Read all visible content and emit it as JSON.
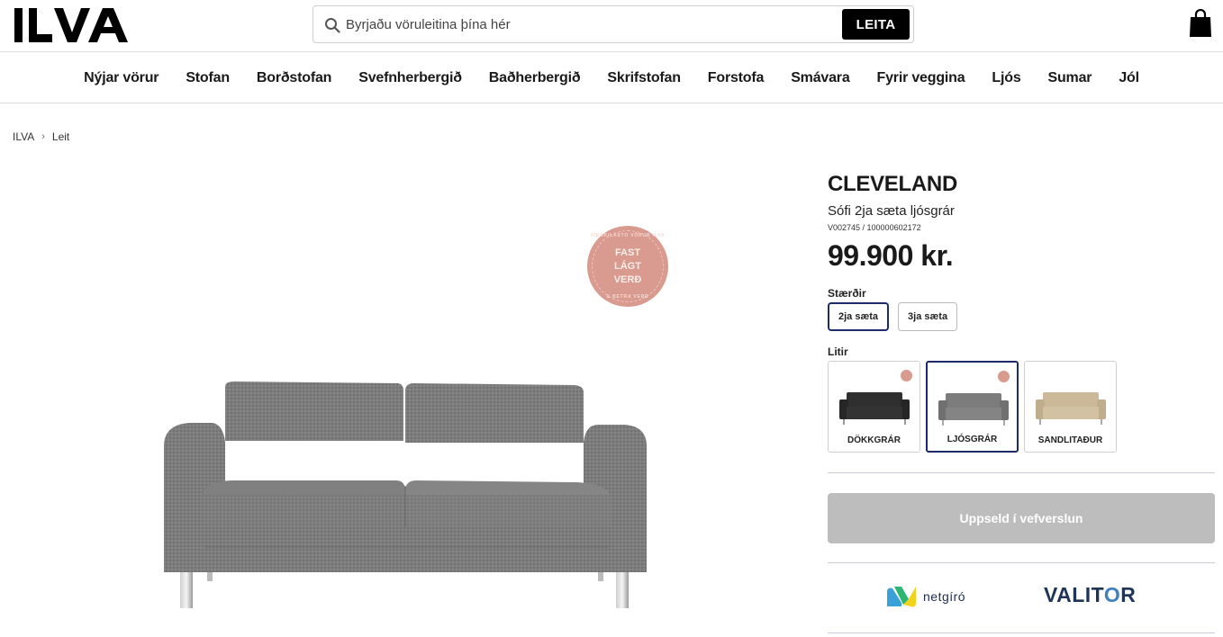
{
  "header": {
    "logo_text": "ILVA",
    "search_placeholder": "Byrjaðu vöruleitina þína hér",
    "search_button": "LEITA",
    "cart_icon": "shopping-bag-icon"
  },
  "nav": {
    "items": [
      "Nýjar vörur",
      "Stofan",
      "Borðstofan",
      "Svefnherbergið",
      "Baðherbergið",
      "Skrifstofan",
      "Forstofa",
      "Smávara",
      "Fyrir veggina",
      "Ljós",
      "Sumar",
      "Jól"
    ]
  },
  "breadcrumb": {
    "home": "ILVA",
    "current": "Leit"
  },
  "badge": {
    "main": "FAST LÁGT VERÐ",
    "ring_top": "VIÐSKILASTO VÖRUR ILVA",
    "ring_bottom": "& BETRA VERÐ"
  },
  "product": {
    "title": "CLEVELAND",
    "subtitle": "Sófi 2ja sæta ljósgrár",
    "sku": "V002745 / 100000602172",
    "price": "99.900 kr.",
    "sizes_label": "Stærðir",
    "sizes": [
      {
        "label": "2ja sæta",
        "selected": true
      },
      {
        "label": "3ja sæta",
        "selected": false
      }
    ],
    "colors_label": "Litir",
    "colors": [
      {
        "label": "DÖKKGRÁR",
        "swatch": "#2f2f2f",
        "selected": false,
        "badge": true
      },
      {
        "label": "LJÓSGRÁR",
        "swatch": "#7c7c7c",
        "selected": true,
        "badge": true
      },
      {
        "label": "SANDLITAÐUR",
        "swatch": "#cbb99a",
        "selected": false,
        "badge": false
      }
    ],
    "buy_button": "Uppseld í vefverslun"
  },
  "payments": {
    "netgiro": "netgíró",
    "valitor_pre": "VALIT",
    "valitor_o": "O",
    "valitor_post": "R"
  },
  "colors": {
    "accent": "#1d2b6b",
    "badge": "#d99a8f",
    "disabled": "#bdbdbd"
  }
}
